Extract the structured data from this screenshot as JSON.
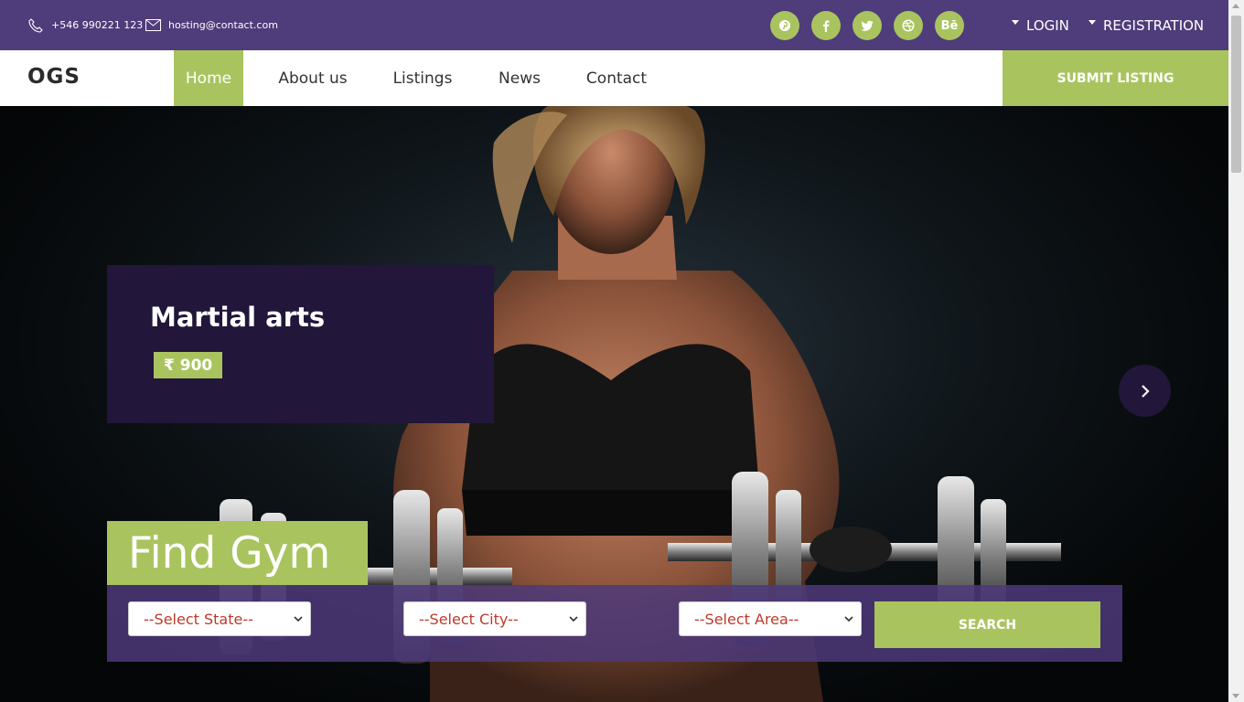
{
  "topbar": {
    "phone": "+546 990221 123",
    "email": "hosting@contact.com",
    "social": [
      {
        "icon": "pinterest-icon"
      },
      {
        "icon": "facebook-icon"
      },
      {
        "icon": "twitter-icon"
      },
      {
        "icon": "dribbble-icon"
      },
      {
        "icon": "behance-icon",
        "label": "Bē"
      }
    ],
    "login": "LOGIN",
    "registration": "REGISTRATION"
  },
  "nav": {
    "logo": "OGS",
    "items": [
      {
        "label": "Home",
        "active": true
      },
      {
        "label": "About us"
      },
      {
        "label": "Listings"
      },
      {
        "label": "News"
      },
      {
        "label": "Contact"
      }
    ],
    "submit": "SUBMIT LISTING"
  },
  "hero": {
    "slide_title": "Martial arts",
    "price": "₹ 900",
    "find_title": "Find Gym",
    "search": {
      "state_placeholder": "--Select State--",
      "city_placeholder": "--Select City--",
      "area_placeholder": "--Select Area--",
      "button": "SEARCH"
    }
  },
  "colors": {
    "purple": "#4f3c7a",
    "dark_purple": "#22163a",
    "green": "#a9c45f",
    "select_text": "#c0392b"
  }
}
